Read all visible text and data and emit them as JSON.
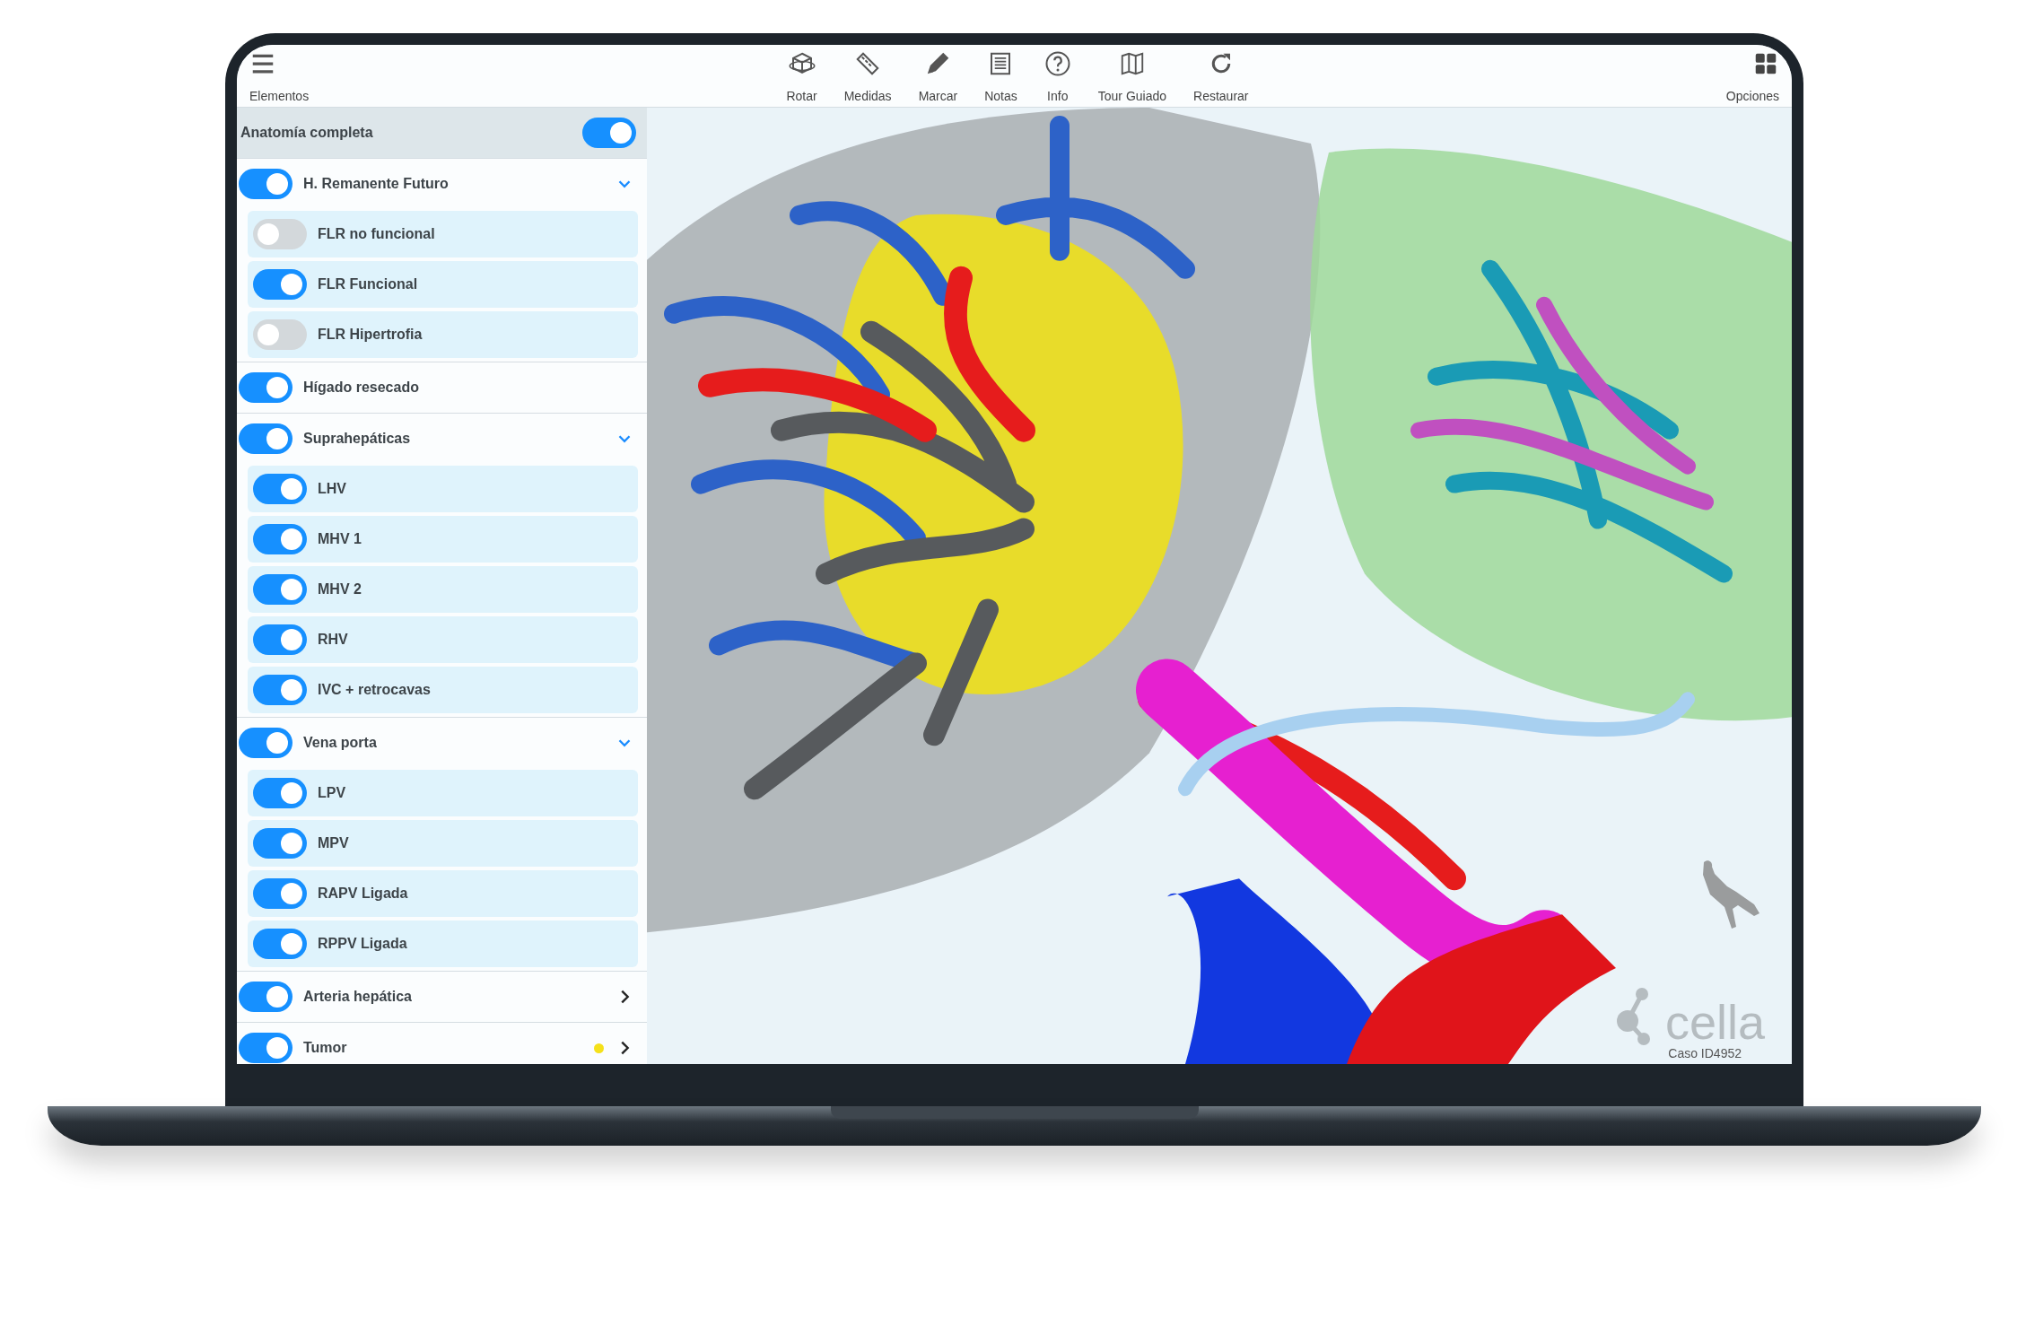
{
  "toolbar": {
    "menu": {
      "label": "Elementos"
    },
    "tools": [
      {
        "label": "Rotar"
      },
      {
        "label": "Medidas"
      },
      {
        "label": "Marcar"
      },
      {
        "label": "Notas"
      },
      {
        "label": "Info"
      },
      {
        "label": "Tour Guiado"
      },
      {
        "label": "Restaurar"
      }
    ],
    "options": {
      "label": "Opciones"
    }
  },
  "sidebar": {
    "header": {
      "label": "Anatomía completa",
      "on": true
    },
    "groups": [
      {
        "label": "H. Remanente Futuro",
        "on": true,
        "expanded": true,
        "children": [
          {
            "label": "FLR no funcional",
            "on": false
          },
          {
            "label": "FLR Funcional",
            "on": true
          },
          {
            "label": "FLR Hipertrofia",
            "on": false
          }
        ]
      },
      {
        "label": "Hígado resecado",
        "on": true
      },
      {
        "label": "Suprahepáticas",
        "on": true,
        "expanded": true,
        "children": [
          {
            "label": "LHV",
            "on": true
          },
          {
            "label": "MHV 1",
            "on": true
          },
          {
            "label": "MHV 2",
            "on": true
          },
          {
            "label": "RHV",
            "on": true
          },
          {
            "label": "IVC + retrocavas",
            "on": true
          }
        ]
      },
      {
        "label": "Vena porta",
        "on": true,
        "expanded": true,
        "children": [
          {
            "label": "LPV",
            "on": true
          },
          {
            "label": "MPV",
            "on": true
          },
          {
            "label": "RAPV Ligada",
            "on": true
          },
          {
            "label": "RPPV Ligada",
            "on": true
          }
        ]
      },
      {
        "label": "Arteria hepática",
        "on": true,
        "expanded": false
      },
      {
        "label": "Tumor",
        "on": true,
        "expanded": false,
        "color": "#f5e11a"
      }
    ]
  },
  "viewer": {
    "logo": "cella",
    "case_id": "Caso ID4952"
  }
}
